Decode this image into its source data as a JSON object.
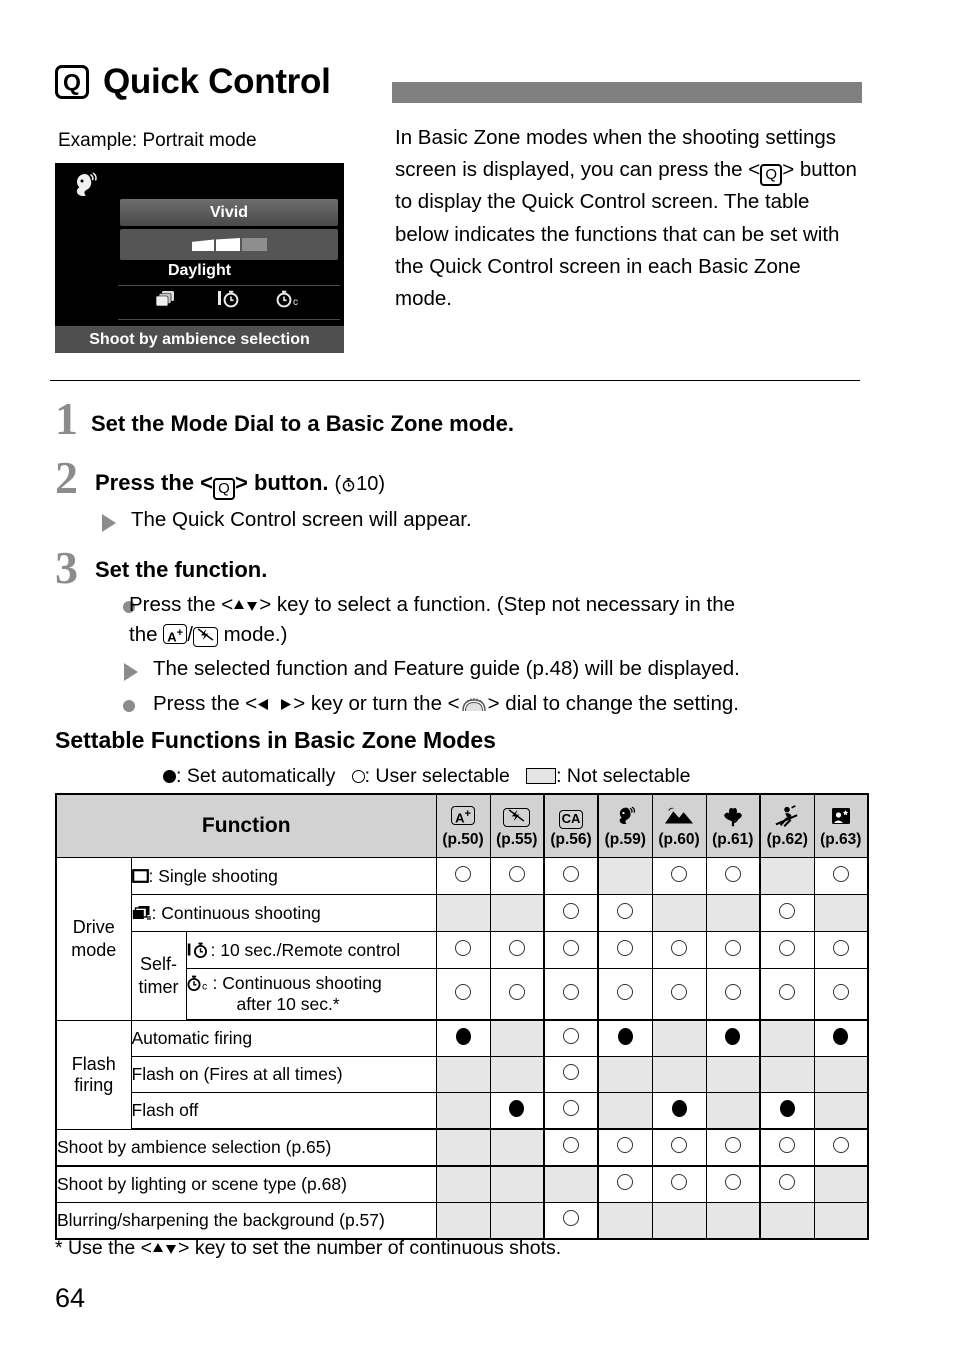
{
  "page": {
    "number": "64",
    "title": "Quick Control",
    "title_badge": "Q"
  },
  "example": {
    "caption": "Example: Portrait mode",
    "screen": {
      "mode_icon": "portrait-mode-icon",
      "ambience_label": "Vivid",
      "white_balance_label": "Daylight",
      "drive_icons": [
        "continuous-shooting-icon",
        "self-timer-10sec-icon",
        "self-timer-continuous-icon"
      ],
      "footer": "Shoot by ambience selection"
    }
  },
  "intro": {
    "part1": "In Basic Zone modes when the shooting settings screen is displayed, you can press the <",
    "badge": "Q",
    "part2": "> button to display the Quick Control screen. The table below indicates the functions that can be set with the Quick Control screen in each Basic Zone mode."
  },
  "steps": [
    {
      "num": "1",
      "title": "Set the Mode Dial to a Basic Zone mode."
    },
    {
      "num": "2",
      "title_a": "Press the <",
      "badge": "Q",
      "title_b": "> button.",
      "timer": "10",
      "bullets": [
        {
          "type": "triangle",
          "text": "The Quick Control screen will appear."
        }
      ]
    },
    {
      "num": "3",
      "title": "Set the function.",
      "bullets": [
        {
          "type": "dot",
          "text_a": "Press the <",
          "key": "up-down-key",
          "text_b": "> key to select a function. (Step not necessary in the",
          "icon_a": "A+",
          "icon_b": "flash-off",
          "text_c": "mode.)"
        },
        {
          "type": "triangle",
          "text": "The selected function and Feature guide (p.48) will be displayed."
        },
        {
          "type": "dot",
          "text_a": "Press the <",
          "key": "left-right-key",
          "text_b": "> key or turn the <",
          "dial": "main-dial",
          "text_c": "> dial to change the setting."
        }
      ]
    }
  ],
  "section": {
    "heading": "Settable Functions in Basic Zone Modes",
    "legend": {
      "filled": ": Set automatically",
      "open": ": User selectable",
      "grey": ": Not selectable"
    }
  },
  "table": {
    "function_header": "Function",
    "modes": [
      {
        "icon": "scene-intelligent-auto-icon",
        "glyph": "A+",
        "page": "(p.50)"
      },
      {
        "icon": "flash-off-icon",
        "glyph": "flash-off",
        "page": "(p.55)"
      },
      {
        "icon": "creative-auto-icon",
        "glyph": "CA",
        "page": "(p.56)"
      },
      {
        "icon": "portrait-icon",
        "glyph": "portrait",
        "page": "(p.59)"
      },
      {
        "icon": "landscape-icon",
        "glyph": "landscape",
        "page": "(p.60)"
      },
      {
        "icon": "close-up-icon",
        "glyph": "close-up",
        "page": "(p.61)"
      },
      {
        "icon": "sports-icon",
        "glyph": "sports",
        "page": "(p.62)"
      },
      {
        "icon": "night-portrait-icon",
        "glyph": "night-portrait",
        "page": "(p.63)"
      }
    ],
    "group_labels": {
      "drive_mode": "Drive mode",
      "self_timer": "Self-timer",
      "flash_firing": "Flash firing"
    },
    "rows": [
      {
        "group": "drive_mode",
        "icon": "single-shooting-icon",
        "label": ": Single shooting",
        "marks": [
          "o",
          "o",
          "o",
          "",
          "o",
          "o",
          "",
          "o"
        ]
      },
      {
        "group": "drive_mode",
        "icon": "continuous-shooting-icon",
        "label": ": Continuous shooting",
        "marks": [
          "",
          "",
          "o",
          "o",
          "",
          "",
          "o",
          ""
        ]
      },
      {
        "group": "self_timer",
        "icon": "self-timer-10sec-icon",
        "label": ": 10 sec./Remote control",
        "marks": [
          "o",
          "o",
          "o",
          "o",
          "o",
          "o",
          "o",
          "o"
        ]
      },
      {
        "group": "self_timer",
        "icon": "self-timer-continuous-icon",
        "label": ": Continuous shooting",
        "label2": "after 10 sec.*",
        "marks": [
          "o",
          "o",
          "o",
          "o",
          "o",
          "o",
          "o",
          "o"
        ]
      },
      {
        "group": "flash_firing",
        "label": "Automatic firing",
        "marks": [
          "f",
          "",
          "o",
          "f",
          "",
          "f",
          "",
          "f"
        ]
      },
      {
        "group": "flash_firing",
        "label": "Flash on (Fires at all times)",
        "marks": [
          "",
          "",
          "o",
          "",
          "",
          "",
          "",
          ""
        ]
      },
      {
        "group": "flash_firing",
        "label": "Flash off",
        "marks": [
          "",
          "f",
          "o",
          "",
          "f",
          "",
          "f",
          ""
        ]
      },
      {
        "group": "",
        "label": "Shoot by ambience selection (p.65)",
        "marks": [
          "",
          "",
          "o",
          "o",
          "o",
          "o",
          "o",
          "o"
        ]
      },
      {
        "group": "",
        "label": "Shoot by lighting or scene type (p.68)",
        "marks": [
          "",
          "",
          "",
          "o",
          "o",
          "o",
          "o",
          ""
        ]
      },
      {
        "group": "",
        "label": "Blurring/sharpening the background (p.57)",
        "marks": [
          "",
          "",
          "o",
          "",
          "",
          "",
          "",
          ""
        ]
      }
    ]
  },
  "footnote": {
    "text_a": "* Use the <",
    "key": "up-down-key",
    "text_b": "> key to set the number of continuous shots."
  }
}
